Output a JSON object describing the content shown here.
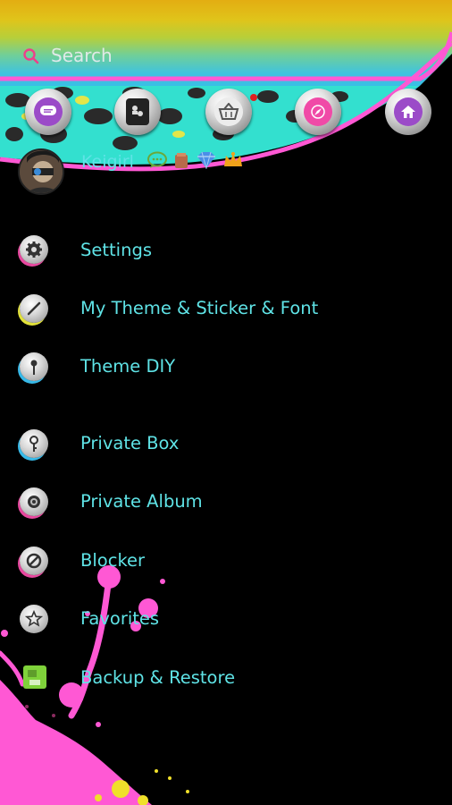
{
  "search": {
    "placeholder": "Search"
  },
  "toolbar": {
    "icons": [
      "messages-icon",
      "contacts-icon",
      "store-icon",
      "discover-icon",
      "home-icon"
    ]
  },
  "profile": {
    "username": "Keigirl"
  },
  "menu": [
    {
      "label": "Settings",
      "icon": "gear-icon"
    },
    {
      "label": "My Theme & Sticker & Font",
      "icon": "brush-icon"
    },
    {
      "label": "Theme DIY",
      "icon": "pin-icon"
    },
    {
      "label": "Private Box",
      "icon": "key-icon"
    },
    {
      "label": "Private Album",
      "icon": "album-icon"
    },
    {
      "label": "Blocker",
      "icon": "block-icon"
    },
    {
      "label": "Favorites",
      "icon": "star-icon"
    },
    {
      "label": "Backup & Restore",
      "icon": "backup-icon"
    }
  ],
  "colors": {
    "accent": "#5fe3e6",
    "pink": "#f05fd0",
    "leopard": "#33e0cf"
  }
}
